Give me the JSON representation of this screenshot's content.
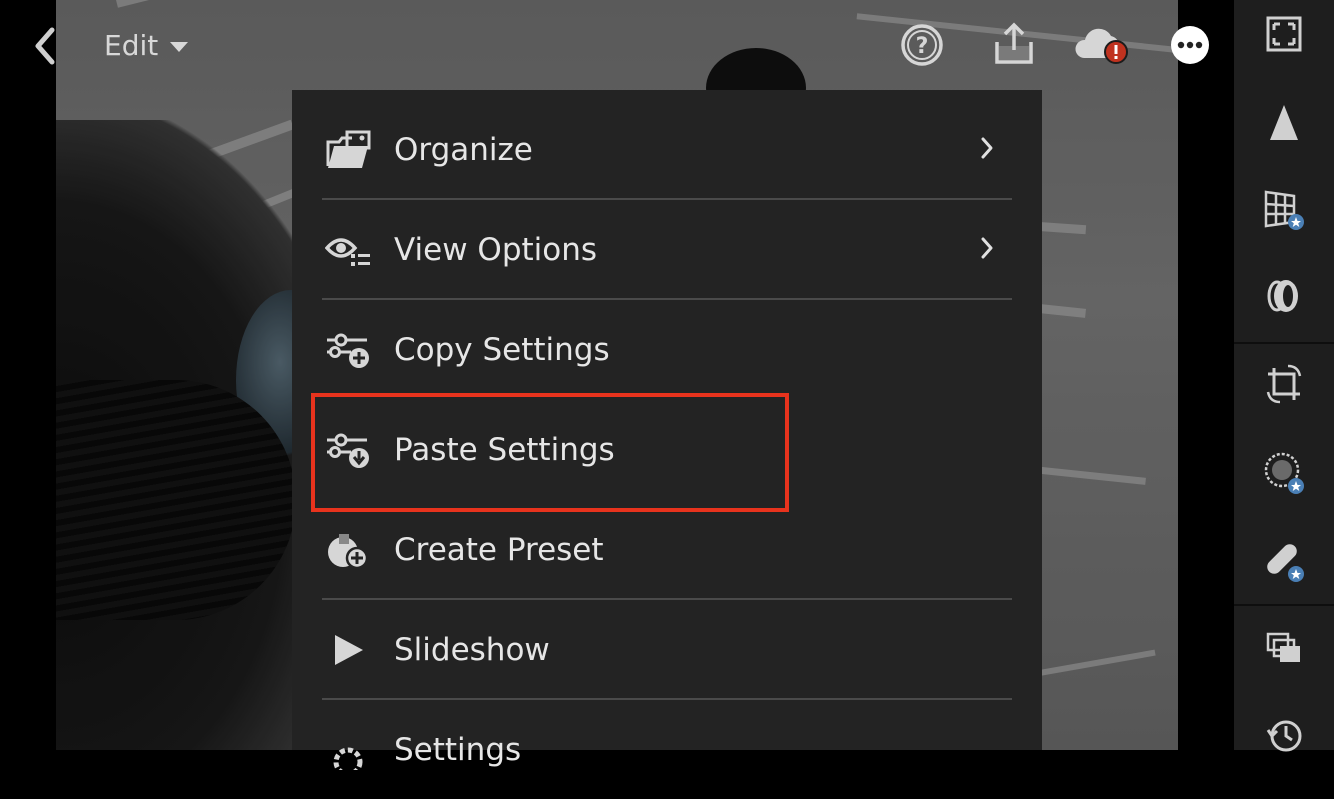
{
  "header": {
    "mode_label": "Edit",
    "icons": [
      "back-icon",
      "help-icon",
      "share-icon",
      "cloud-error-icon",
      "more-icon"
    ]
  },
  "menu": {
    "items": [
      {
        "label": "Organize",
        "icon": "folder-photos-icon",
        "has_submenu": true
      },
      {
        "label": "View Options",
        "icon": "eye-list-icon",
        "has_submenu": true
      },
      {
        "label": "Copy Settings",
        "icon": "sliders-plus-icon",
        "has_submenu": false
      },
      {
        "label": "Paste Settings",
        "icon": "sliders-download-icon",
        "has_submenu": false,
        "highlighted": true
      },
      {
        "label": "Create Preset",
        "icon": "preset-plus-icon",
        "has_submenu": false
      },
      {
        "label": "Slideshow",
        "icon": "play-icon",
        "has_submenu": false
      },
      {
        "label": "Settings",
        "icon": "gear-icon",
        "has_submenu": false
      }
    ]
  },
  "right_toolbar": {
    "tools": [
      "fit-frame-icon",
      "tone-icon",
      "geometry-grid-icon",
      "optics-lens-icon",
      "crop-rotate-icon",
      "selective-brush-icon",
      "healing-bandage-icon",
      "versions-icon",
      "history-icon"
    ]
  },
  "colors": {
    "menu_bg": "#232323",
    "highlight": "#e8331d",
    "error_badge": "#c0321f",
    "text": "#e6e6e6"
  }
}
